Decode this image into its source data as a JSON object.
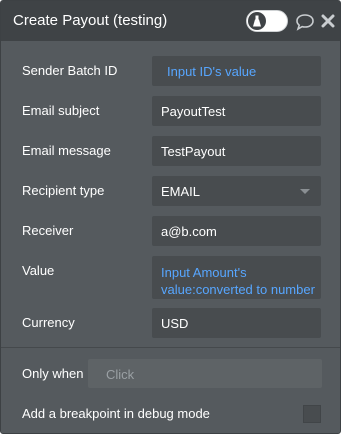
{
  "header": {
    "title": "Create Payout (testing)"
  },
  "rows": {
    "sender_batch_id": {
      "label": "Sender Batch ID",
      "value": "Input ID's value"
    },
    "email_subject": {
      "label": "Email subject",
      "value": "PayoutTest"
    },
    "email_message": {
      "label": "Email message",
      "value": "TestPayout"
    },
    "recipient_type": {
      "label": "Recipient type",
      "value": "EMAIL"
    },
    "receiver": {
      "label": "Receiver",
      "value": "a@b.com"
    },
    "value": {
      "label": "Value",
      "value": "Input Amount's value:converted to number"
    },
    "currency": {
      "label": "Currency",
      "value": "USD"
    }
  },
  "conditions": {
    "only_when_label": "Only when",
    "only_when_placeholder": "Click",
    "breakpoint_label": "Add a breakpoint in debug mode"
  },
  "icons": {
    "comment": "comment-icon",
    "close": "close-icon",
    "toggle": "debug-toggle"
  },
  "colors": {
    "panel": "#555a5e",
    "header": "#3f4346",
    "field": "#484c4f",
    "dynamic_text": "#57a6ff"
  }
}
